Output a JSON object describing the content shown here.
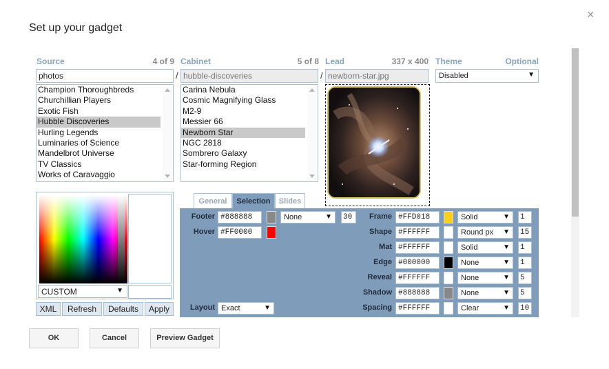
{
  "dialog": {
    "title": "Set up your gadget",
    "close": "×"
  },
  "source": {
    "label": "Source",
    "count": "4 of 9",
    "value": "photos",
    "items": [
      "Champion Thoroughbreds",
      "Churchillian Players",
      "Exotic Fish",
      "Hubble Discoveries",
      "Hurling Legends",
      "Luminaries of Science",
      "Mandelbrot Universe",
      "TV Classics",
      "Works of Caravaggio"
    ],
    "selected_index": 3
  },
  "cabinet": {
    "label": "Cabinet",
    "count": "5 of 8",
    "value": "hubble-discoveries",
    "items": [
      "Carina Nebula",
      "Cosmic Magnifying Glass",
      "M2-9",
      "Messier 66",
      "Newborn Star",
      "NGC 2818",
      "Sombrero Galaxy",
      "Star-forming Region"
    ],
    "selected_index": 4
  },
  "separators": {
    "slash": "/"
  },
  "lead": {
    "label": "Lead",
    "count": "337 x 400",
    "value": "newborn-star.jpg"
  },
  "theme": {
    "label": "Theme",
    "optional": "Optional",
    "value": "Disabled"
  },
  "colorpicker": {
    "preset": "CUSTOM"
  },
  "picker_buttons": {
    "xml": "XML",
    "refresh": "Refresh",
    "defaults": "Defaults",
    "apply": "Apply"
  },
  "tabs": {
    "general": "General",
    "selection": "Selection",
    "slides": "Slides",
    "active": "Selection"
  },
  "selection": {
    "footer": {
      "label": "Footer",
      "hex": "#888888",
      "color": "#888888",
      "style": "None",
      "size": "30"
    },
    "hover": {
      "label": "Hover",
      "hex": "#FF0000",
      "color": "#FF0000"
    },
    "layout": {
      "label": "Layout",
      "value": "Exact"
    },
    "rows": [
      {
        "label": "Frame",
        "hex": "#FFD018",
        "color": "#FFD018",
        "style": "Solid",
        "num": "1"
      },
      {
        "label": "Shape",
        "hex": "#FFFFFF",
        "color": "#FFFFFF",
        "style": "Round px",
        "num": "15"
      },
      {
        "label": "Mat",
        "hex": "#FFFFFF",
        "color": "#FFFFFF",
        "style": "Solid",
        "num": "1"
      },
      {
        "label": "Edge",
        "hex": "#000000",
        "color": "#000000",
        "style": "None",
        "num": "1"
      },
      {
        "label": "Reveal",
        "hex": "#FFFFFF",
        "color": "#FFFFFF",
        "style": "None",
        "num": "5"
      },
      {
        "label": "Shadow",
        "hex": "#888888",
        "color": "#888888",
        "style": "None",
        "num": "5"
      },
      {
        "label": "Spacing",
        "hex": "#FFFFFF",
        "color": "#FFFFFF",
        "style": "Clear",
        "num": "10"
      }
    ]
  },
  "footer": {
    "ok": "OK",
    "cancel": "Cancel",
    "preview": "Preview Gadget"
  },
  "colors": {
    "header_blue": "#8aa4bf",
    "panel": "#7f9cbb",
    "selected_row": "#c9c9c9"
  }
}
